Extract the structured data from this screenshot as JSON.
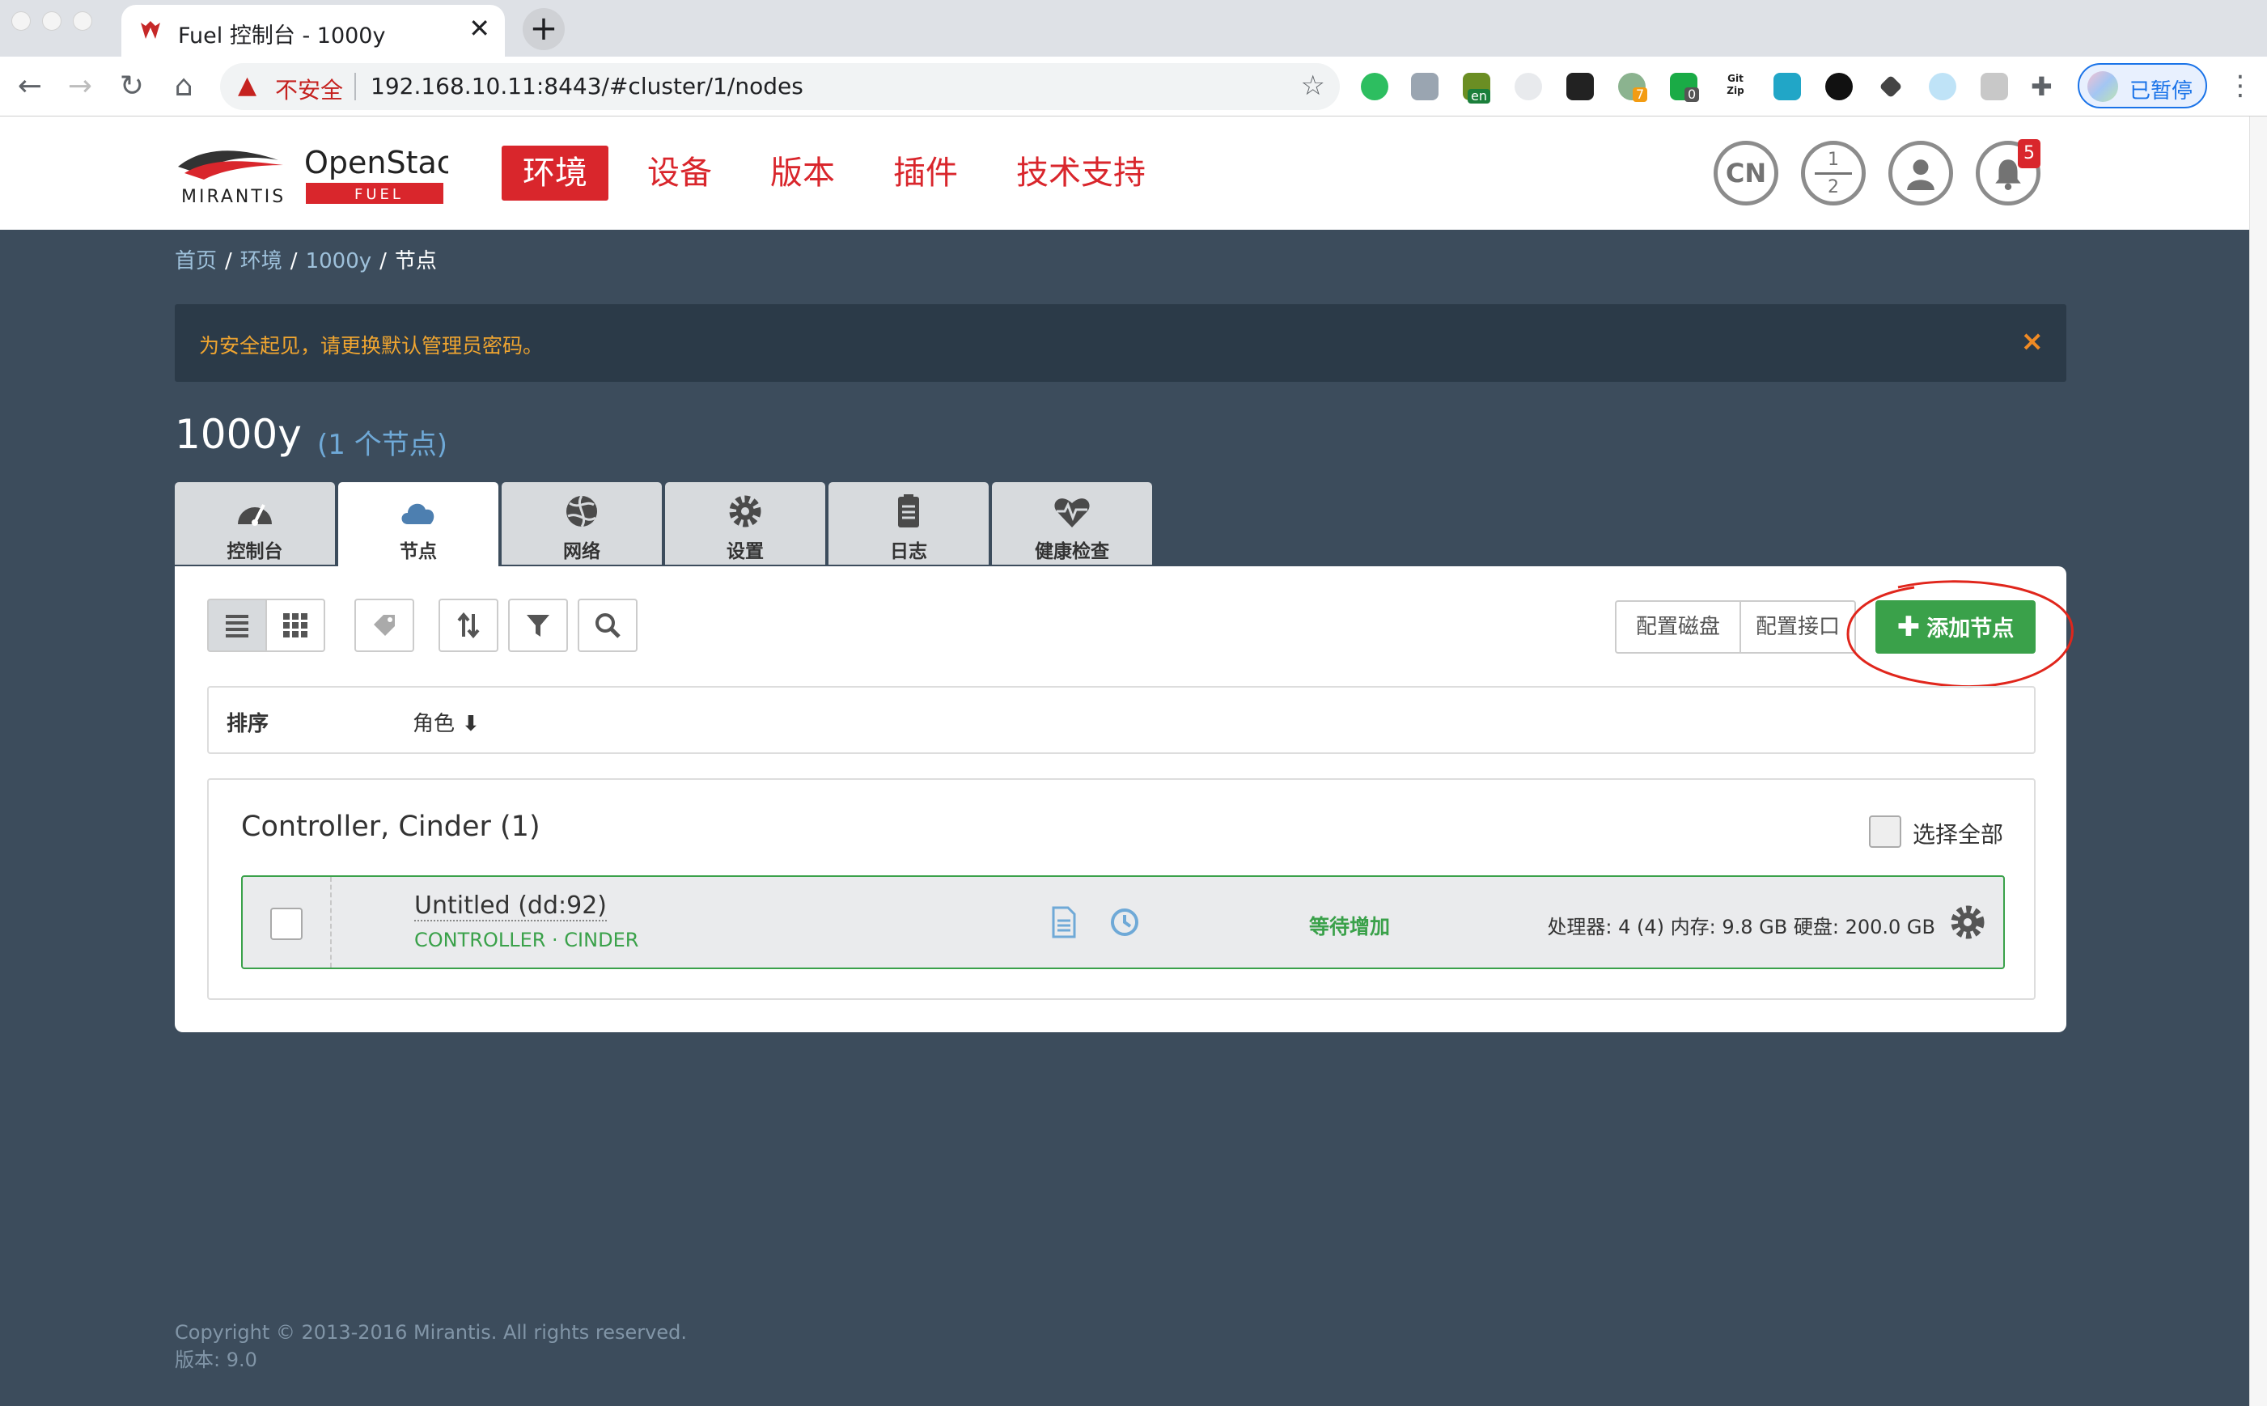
{
  "browser": {
    "tab_title": "Fuel 控制台 - 1000y",
    "new_tab_symbol": "+",
    "tab_close_symbol": "✕",
    "security_label": "不安全",
    "url": "192.168.10.11:8443/#cluster/1/nodes",
    "profile_status": "已暂停",
    "extension_badges": {
      "green_circle": "7",
      "shield": "0",
      "lang": "en",
      "gitzip": "Git Zip"
    }
  },
  "app": {
    "logo": {
      "brand": "MIRANTIS",
      "product": "OpenStack",
      "sub": "FUEL"
    },
    "nav": [
      "环境",
      "设备",
      "版本",
      "插件",
      "技术支持"
    ],
    "header_buttons": {
      "language": "CN",
      "stats_top": "1",
      "stats_bottom": "2",
      "notifications": "5"
    }
  },
  "breadcrumb": [
    "首页",
    "环境",
    "1000y",
    "节点"
  ],
  "alert": {
    "text": "为安全起见，请更换默认管理员密码。",
    "close": "×"
  },
  "environment": {
    "name": "1000y",
    "node_count": "(1 个节点)"
  },
  "env_tabs": [
    {
      "label": "控制台",
      "icon": "dashboard-icon"
    },
    {
      "label": "节点",
      "icon": "cloud-icon"
    },
    {
      "label": "网络",
      "icon": "network-icon"
    },
    {
      "label": "设置",
      "icon": "gear-icon"
    },
    {
      "label": "日志",
      "icon": "clipboard-icon"
    },
    {
      "label": "健康检查",
      "icon": "heart-icon"
    }
  ],
  "toolbar": {
    "configure_disks": "配置磁盘",
    "configure_interfaces": "配置接口",
    "add_nodes": "添加节点"
  },
  "sort": {
    "label": "排序",
    "field": "角色"
  },
  "node_group": {
    "title": "Controller, Cinder (1)",
    "select_all": "选择全部",
    "nodes": [
      {
        "name": "Untitled (dd:92)",
        "roles": "CONTROLLER · CINDER",
        "status": "等待增加",
        "hardware": "处理器: 4 (4)  内存: 9.8 GB  硬盘: 200.0 GB"
      }
    ]
  },
  "footer": {
    "copyright": "Copyright © 2013-2016 Mirantis. All rights reserved.",
    "version": "版本: 9.0"
  },
  "colors": {
    "accent_red": "#d9262c",
    "success_green": "#3aa14a",
    "page_bg": "#3c4c5c",
    "alert_text": "#f0a530",
    "annotation": "#e0261c"
  }
}
